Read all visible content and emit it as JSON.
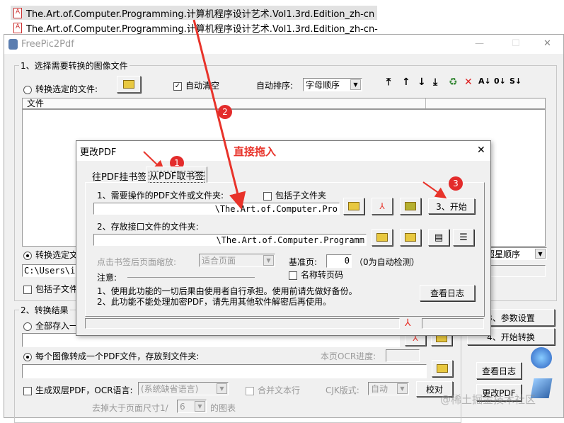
{
  "explorer": {
    "files": [
      "The.Art.of.Computer.Programming.计算机程序设计艺术.Vol1.3rd.Edition_zh-cn",
      "The.Art.of.Computer.Programming.计算机程序设计艺术.Vol1.3rd.Edition_zh-cn-"
    ]
  },
  "window": {
    "title": "FreePic2Pdf",
    "minimize": "—",
    "maximize": "☐",
    "close": "✕"
  },
  "group1": {
    "label": "1、选择需要转换的图像文件",
    "radio_selected_files": "转换选定的文件:",
    "auto_clear": "自动清空",
    "auto_sort_label": "自动排序:",
    "auto_sort_value": "字母顺序",
    "list_header": "文件",
    "radio_selected_folder": "转换选定文",
    "folder_path": "C:\\Users\\id",
    "include_subfolders": "包括子文件",
    "sort2_value": "超星顺序",
    "toolbar": [
      "⤒",
      "↑",
      "↓",
      "⤓",
      "♻",
      "✕",
      "A↓",
      "0↓",
      "S↓"
    ]
  },
  "group2": {
    "label": "2、转换结果",
    "radio_all_in_one": "全部存入一",
    "radio_each_image": "每个图像转成一个PDF文件，存放到文件夹:",
    "ocr_progress_label": "本页OCR进度:",
    "dual_layer": "生成双层PDF，OCR语言:",
    "ocr_language": "(系统缺省语言)",
    "merge_lines": "合并文本行",
    "cjk_label": "CJK版式:",
    "cjk_value": "自动",
    "proofread": "校对",
    "remove_prefix": "去掉大于页面尺寸1/",
    "remove_value": "6",
    "remove_suffix": "的图表"
  },
  "right_buttons": {
    "settings": "3、参数设置",
    "start_convert": "4、开始转换",
    "view_log": "查看日志",
    "modify_pdf": "更改PDF"
  },
  "dialog": {
    "title": "更改PDF",
    "close": "✕",
    "tabs": [
      "往PDF挂书签",
      "从PDF取书签"
    ],
    "pdf_label": "1、需要操作的PDF文件或文件夹:",
    "include_sub": "包括子文件夹",
    "pdf_path": "\\The.Art.of.Computer.Pro",
    "start": "3、开始",
    "interface_label": "2、存放接口文件的文件夹:",
    "interface_path": "\\The.Art.of.Computer.Programm",
    "zoom_label": "点击书签后页面缩放:",
    "zoom_value": "适合页面",
    "base_page_label": "基准页:",
    "base_page_value": "0",
    "auto_detect_hint": "（0为自动检测）",
    "name_to_page": "名称转页码",
    "note_label": "注意:",
    "notes": [
      "1、使用此功能的一切后果由使用者自行承担。使用前请先做好备份。",
      "2、此功能不能处理加密PDF，请先用其他软件解密后再使用。"
    ],
    "view_log": "查看日志"
  },
  "annotations": {
    "drag_text": "直接拖入",
    "steps": [
      "1",
      "2",
      "3"
    ]
  },
  "watermark": "@稀土掘金技术社区",
  "colors": {
    "annotation": "#e8332a"
  }
}
